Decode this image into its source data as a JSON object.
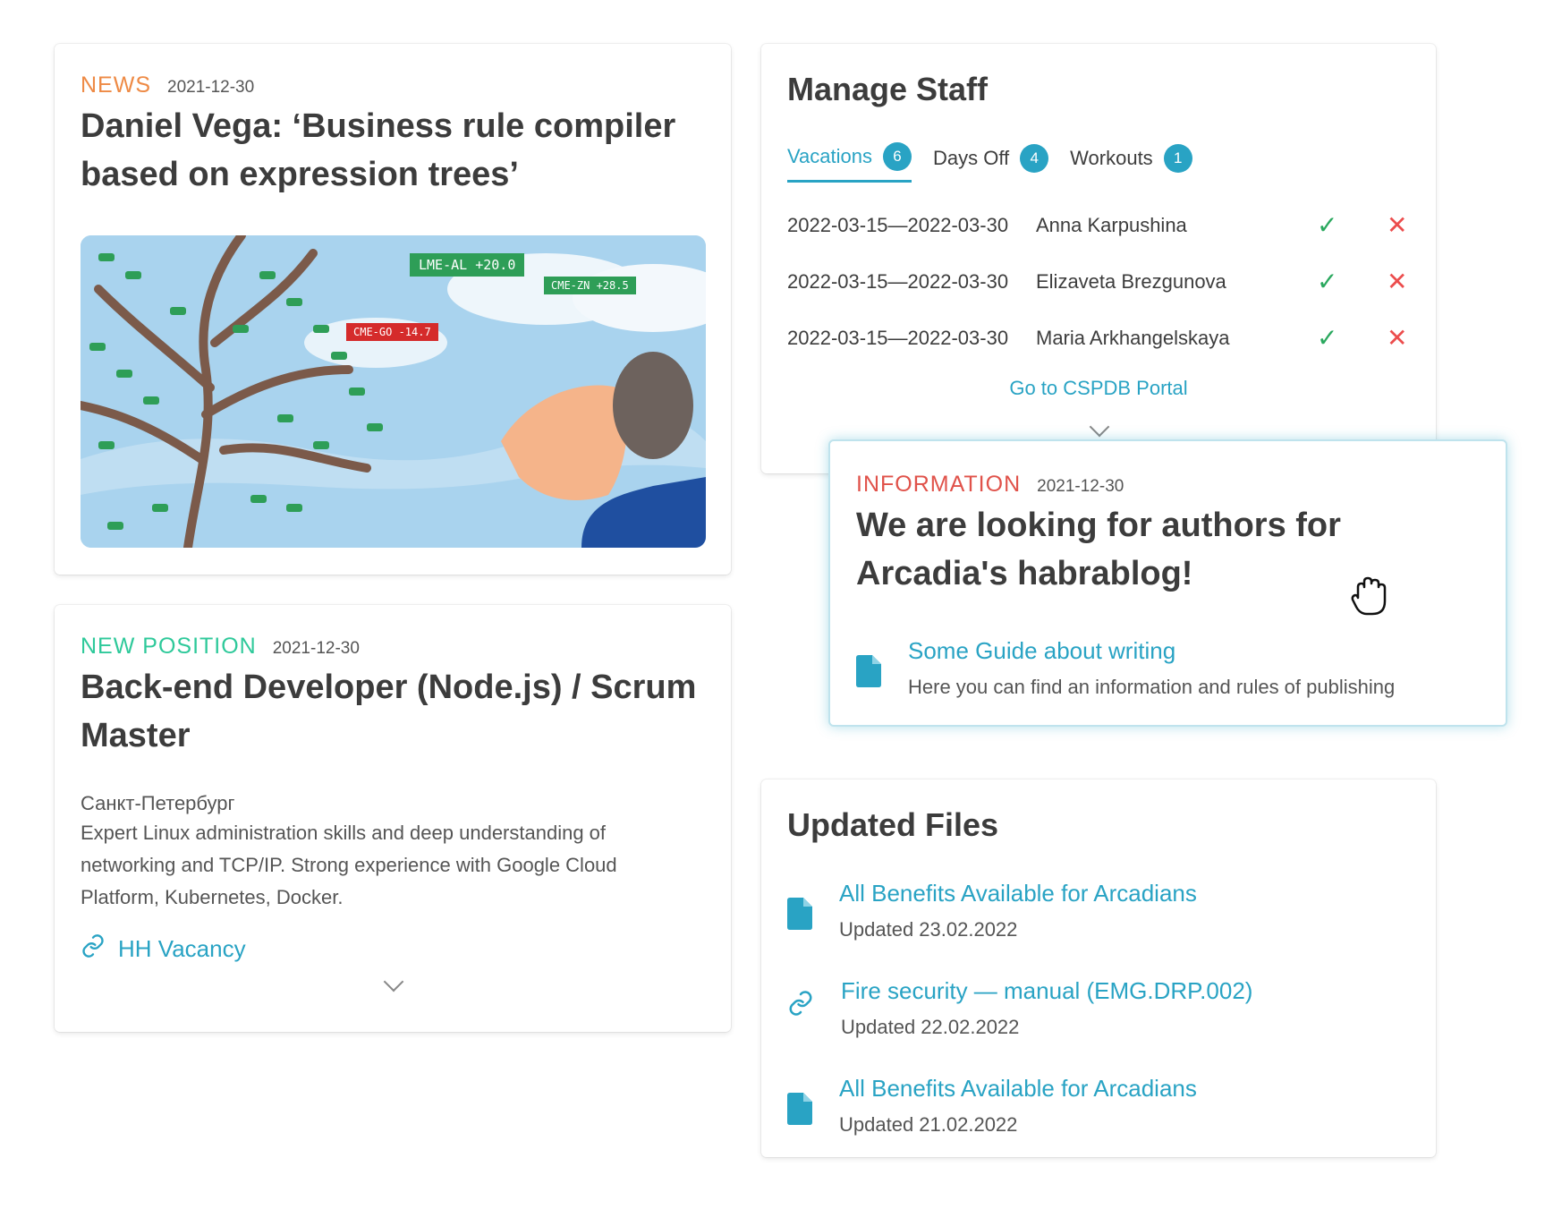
{
  "news": {
    "tag": "NEWS",
    "date": "2021-12-30",
    "title": "Daniel Vega: ‘Business rule compiler based on expression trees’",
    "image": {
      "tickers": [
        "LME-AL +20.0",
        "CME-ZN +28.5",
        "CME-GO -14.7"
      ]
    }
  },
  "position": {
    "tag": "NEW POSITION",
    "date": "2021-12-30",
    "title": "Back-end Developer (Node.js) / Scrum Master",
    "city": "Санкт-Петербург",
    "description": "Expert Linux administration skills and deep understanding of networking and TCP/IP. Strong experience with Google Cloud Platform, Kubernetes, Docker.",
    "link_label": "HH Vacancy"
  },
  "staff": {
    "title": "Manage Staff",
    "tabs": [
      {
        "label": "Vacations",
        "count": "6"
      },
      {
        "label": "Days Off",
        "count": "4"
      },
      {
        "label": "Workouts",
        "count": "1"
      }
    ],
    "rows": [
      {
        "dates": "2022-03-15—2022-03-30",
        "name": "Anna Karpushina"
      },
      {
        "dates": "2022-03-15—2022-03-30",
        "name": "Elizaveta Brezgunova"
      },
      {
        "dates": "2022-03-15—2022-03-30",
        "name": "Maria Arkhangelskaya"
      }
    ],
    "portal_link": "Go to CSPDB Portal"
  },
  "info": {
    "tag": "INFORMATION",
    "date": "2021-12-30",
    "title": "We are looking for authors for Arcadia's habrablog!",
    "guide_title": "Some Guide about writing",
    "guide_sub": "Here you can find an information and rules of publishing"
  },
  "files": {
    "title": "Updated Files",
    "items": [
      {
        "icon": "document-icon",
        "title": "All Benefits Available for Arcadians",
        "updated": "Updated 23.02.2022"
      },
      {
        "icon": "link-icon",
        "title": "Fire security — manual (EMG.DRP.002)",
        "updated": "Updated 22.02.2022"
      },
      {
        "icon": "document-icon",
        "title": "All Benefits Available for Arcadians",
        "updated": "Updated 21.02.2022"
      }
    ]
  },
  "colors": {
    "accent": "#29a3c4",
    "news": "#ee8a45",
    "position": "#2ec99a",
    "information": "#e0524a",
    "approve": "#2aa85e",
    "reject": "#ec4d4d"
  }
}
